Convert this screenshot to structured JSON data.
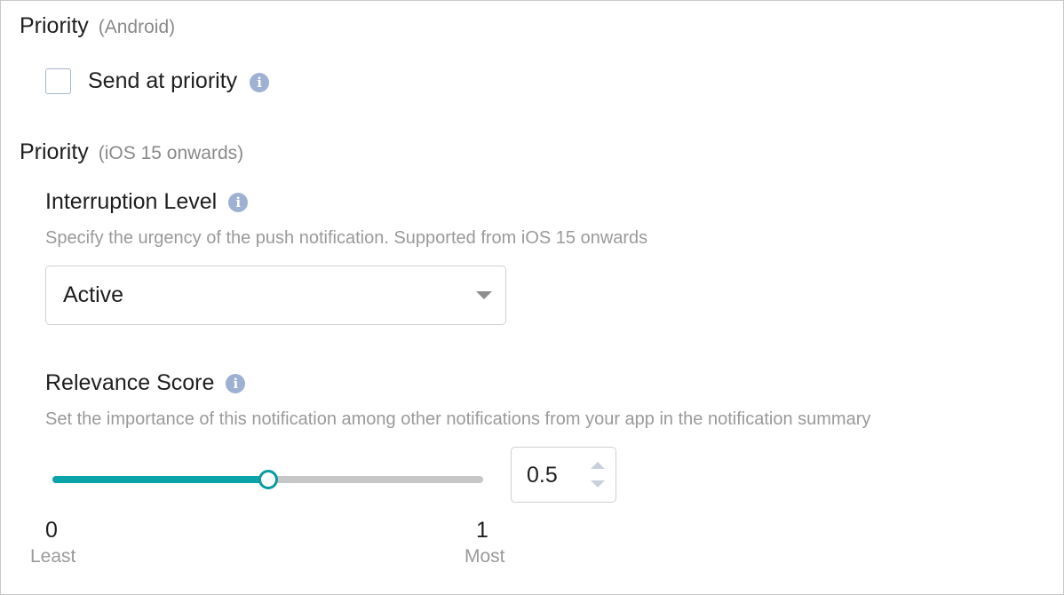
{
  "android_priority": {
    "title": "Priority",
    "subtitle": "(Android)",
    "checkbox_label": "Send at priority",
    "checked": false,
    "info_icon": "info-icon"
  },
  "ios_priority": {
    "title": "Priority",
    "subtitle": "(iOS 15 onwards)"
  },
  "interruption_level": {
    "title": "Interruption Level",
    "description": "Specify the urgency of the push notification. Supported from iOS 15 onwards",
    "selected_value": "Active",
    "info_icon": "info-icon"
  },
  "relevance_score": {
    "title": "Relevance Score",
    "description": "Set the importance of this notification among other notifications from your app in the notification summary",
    "value": 0.5,
    "value_text": "0.5",
    "min": 0,
    "max": 1,
    "min_label": "0",
    "max_label": "1",
    "min_caption": "Least",
    "max_caption": "Most",
    "info_icon": "info-icon"
  },
  "colors": {
    "accent": "#0aa3a8",
    "track": "#c7c7c7",
    "info_icon": "#9fb1d3",
    "muted_text": "#9a9a9a"
  }
}
